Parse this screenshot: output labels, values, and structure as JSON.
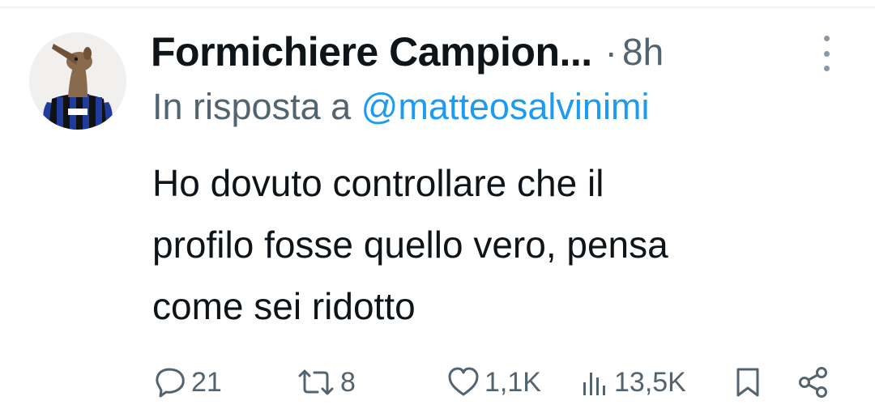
{
  "tweet": {
    "author": {
      "display_name": "Formichiere Campion...",
      "avatar": "anteater-in-football-jersey"
    },
    "separator": "·",
    "time": "8h",
    "reply_to": {
      "prefix": "In risposta a",
      "handle": "@matteosalvinimi"
    },
    "text_lines": [
      "Ho dovuto controllare che il",
      "profilo fosse quello vero, pensa",
      "come sei ridotto"
    ]
  },
  "actions": {
    "replies": "21",
    "reposts": "8",
    "likes": "1,1K",
    "views": "13,5K"
  },
  "icons": {
    "more": "more-vertical-icon",
    "reply": "reply-bubble-icon",
    "repost": "repost-arrows-icon",
    "like": "heart-icon",
    "views": "views-bars-icon",
    "bookmark": "bookmark-icon",
    "share": "share-icon"
  },
  "colors": {
    "text": "#0f1419",
    "secondary": "#536471",
    "link": "#1d9bf0",
    "jersey_blue": "#1f3c9c",
    "jersey_black": "#111111"
  }
}
